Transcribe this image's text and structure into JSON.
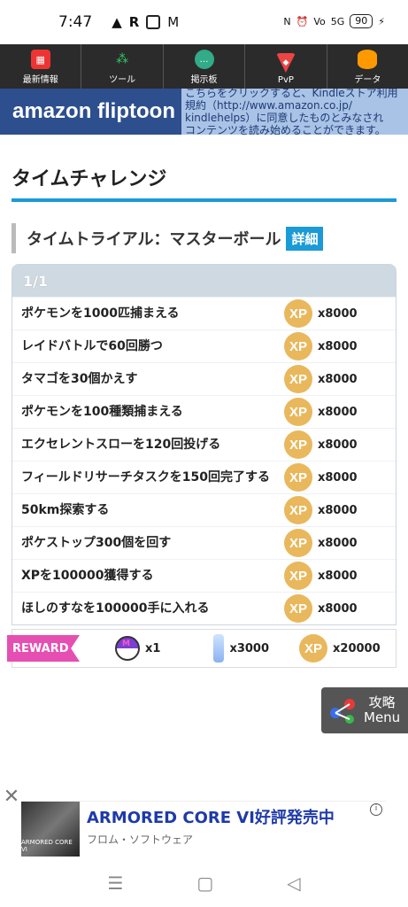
{
  "status": {
    "time": "7:47",
    "battery": "90",
    "network": "5G"
  },
  "nav": [
    {
      "label": "最新情報",
      "icon": "calendar-icon"
    },
    {
      "label": "ツール",
      "icon": "share-icon"
    },
    {
      "label": "掲示板",
      "icon": "chat-icon"
    },
    {
      "label": "PvP",
      "icon": "shield-icon"
    },
    {
      "label": "データ",
      "icon": "database-icon"
    }
  ],
  "banner": {
    "logo": "amazon fliptoon",
    "line1": "こちらをクリックすると、Kindleストア利用",
    "line2": "規約（http://www.amazon.co.jp/",
    "line3": "kindlehelps）に同意したものとみなされ",
    "line4": "コンテンツを読み始めることができます。"
  },
  "section_title": "タイムチャレンジ",
  "subhead": {
    "title": "タイムトライアル：マスターボール",
    "detail": "詳細"
  },
  "task_header": "1/1",
  "tasks": [
    {
      "text": "ポケモンを1000匹捕まえる",
      "amount": "x8000"
    },
    {
      "text": "レイドバトルで60回勝つ",
      "amount": "x8000"
    },
    {
      "text": "タマゴを30個かえす",
      "amount": "x8000"
    },
    {
      "text": "ポケモンを100種類捕まえる",
      "amount": "x8000"
    },
    {
      "text": "エクセレントスローを120回投げる",
      "amount": "x8000"
    },
    {
      "text": "フィールドリサーチタスクを150回完了する",
      "amount": "x8000"
    },
    {
      "text": "50km探索する",
      "amount": "x8000"
    },
    {
      "text": "ポケストップ300個を回す",
      "amount": "x8000"
    },
    {
      "text": "XPを100000獲得する",
      "amount": "x8000"
    },
    {
      "text": "ほしのすなを100000手に入れる",
      "amount": "x8000"
    }
  ],
  "xp_label": "XP",
  "reward": {
    "tag": "REWARD",
    "ball_qty": "x1",
    "stardust_qty": "x3000",
    "xp_qty": "x20000"
  },
  "menu": {
    "line1": "攻略",
    "line2": "Menu"
  },
  "ad": {
    "title": "ARMORED CORE VI好評発売中",
    "sub": "フロム・ソフトウェア",
    "img_text": "ARMORED CORE VI"
  }
}
